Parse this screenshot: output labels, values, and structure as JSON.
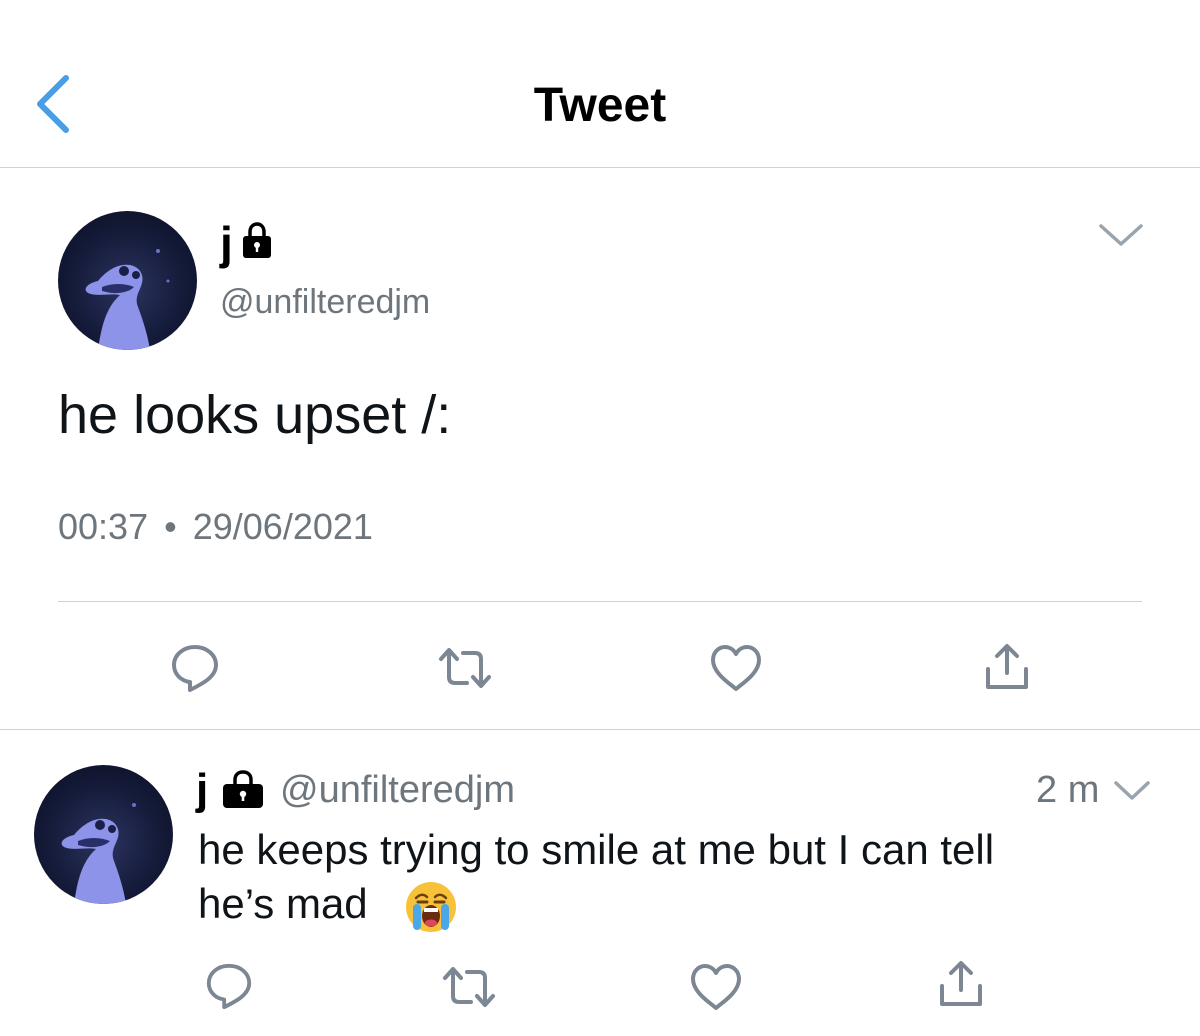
{
  "header": {
    "title": "Tweet",
    "back_icon": "chevron-left-icon",
    "accent_color": "#4a9ee6"
  },
  "main_tweet": {
    "display_name": "j",
    "handle": "@unfilteredjm",
    "text": "he looks upset /:",
    "time": "00:37",
    "separator": "•",
    "date": "29/06/2021",
    "actions": [
      "reply-icon",
      "retweet-icon",
      "like-icon",
      "share-icon"
    ]
  },
  "reply": {
    "display_name": "j",
    "handle": "@unfilteredjm",
    "age": "2 m",
    "text_line1": "he keeps trying to smile at me but I can tell",
    "text_line2": "he’s mad",
    "emoji": "loudly-crying-face",
    "actions": [
      "reply-icon",
      "retweet-icon",
      "like-icon",
      "share-icon"
    ]
  },
  "colors": {
    "icon_gray": "#7c8793",
    "divider": "#cfd3d8"
  }
}
